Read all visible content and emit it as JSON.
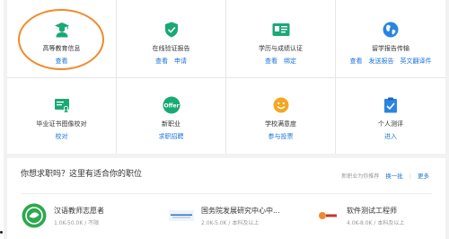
{
  "services": [
    {
      "label": "高等教育信息",
      "icon": "graduate-icon",
      "links": [
        "查看"
      ]
    },
    {
      "label": "在线验证报告",
      "icon": "shield-check-icon",
      "links": [
        "查看",
        "申请"
      ]
    },
    {
      "label": "学历与成绩认证",
      "icon": "id-card-icon",
      "links": [
        "查看",
        "绑定"
      ]
    },
    {
      "label": "留学报告传输",
      "icon": "globe-icon",
      "links": [
        "查看",
        "发送报告",
        "英文翻译件"
      ]
    },
    {
      "label": "毕业证书图像校对",
      "icon": "certificate-icon",
      "links": [
        "校对"
      ]
    },
    {
      "label": "新职业",
      "icon": "offer-icon",
      "links": [
        "求职招聘"
      ]
    },
    {
      "label": "学校满意度",
      "icon": "smiley-icon",
      "links": [
        "参与投票"
      ]
    },
    {
      "label": "个人测评",
      "icon": "clipboard-check-icon",
      "links": [
        "进入"
      ]
    }
  ],
  "jobs_panel": {
    "title": "你想求职吗？这里有适合你的职位",
    "hint": "新职业为你推荐",
    "refresh_label": "换一批",
    "separator": "|",
    "more_label": "更多"
  },
  "jobs": [
    {
      "title": "汉语教师志愿者",
      "meta": "1.0K-50.0K / 不限"
    },
    {
      "title": "国务院发展研究中心中...",
      "meta": "2.0K-5.0K / 本科及以上"
    },
    {
      "title": "软件测试工程师",
      "meta": "4.0K-8.0K / 本科及以上"
    }
  ],
  "colors": {
    "accent_green": "#19a974",
    "highlight_orange": "#f08a2c",
    "link_blue": "#1a73d8",
    "globe_blue": "#2a84e2",
    "smiley_yellow": "#f5a623"
  }
}
